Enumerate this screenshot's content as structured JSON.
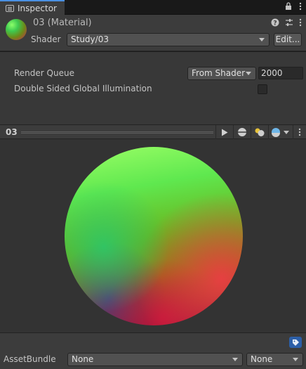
{
  "tab": {
    "label": "Inspector"
  },
  "material": {
    "title": "03 (Material)",
    "shader_label": "Shader",
    "shader_value": "Study/03",
    "edit_label": "Edit..."
  },
  "properties": {
    "render_queue_label": "Render Queue",
    "render_queue_dropdown": "From Shader",
    "render_queue_value": "2000",
    "double_sided_label": "Double Sided Global Illumination",
    "double_sided_checked": false
  },
  "preview": {
    "title": "03"
  },
  "asset_bundle": {
    "label": "AssetBundle",
    "name_value": "None",
    "variant_value": "None"
  },
  "colors": {
    "accent": "#4a90e2",
    "panel": "#3c3c3c",
    "tag": "#2c5fa8"
  }
}
